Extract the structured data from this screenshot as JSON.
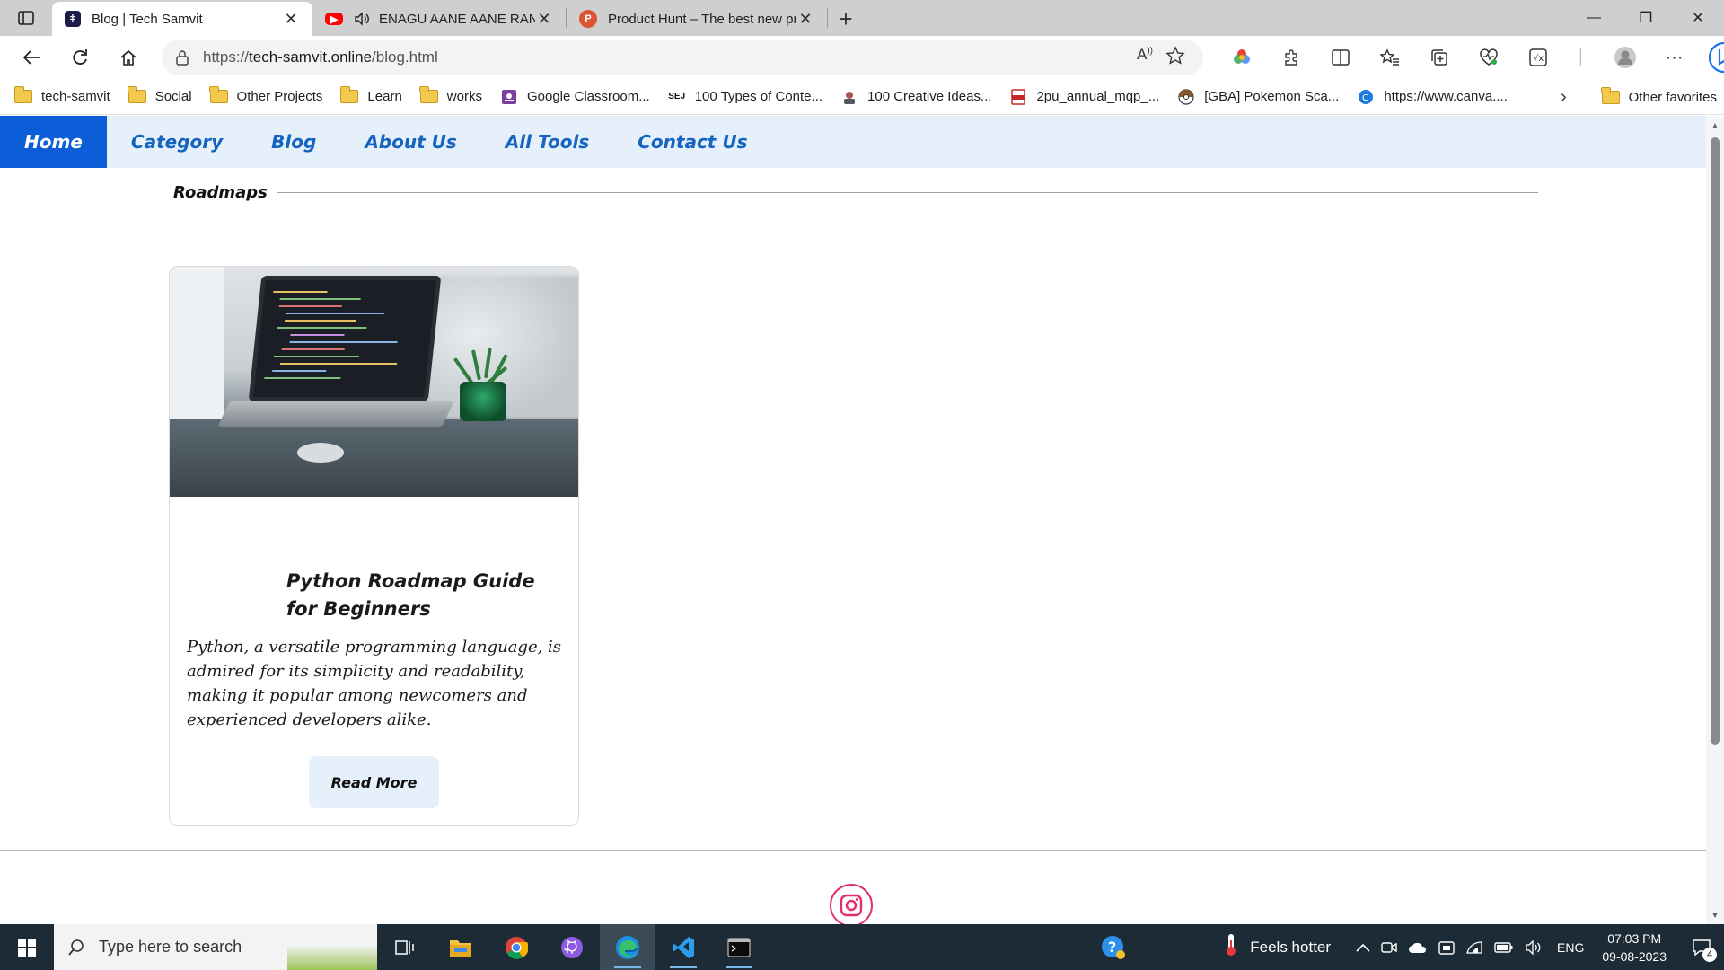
{
  "browser": {
    "tabs": [
      {
        "title": "Blog | Tech Samvit",
        "active": true
      },
      {
        "title": "ENAGU AANE AANE RANGA",
        "active": false
      },
      {
        "title": "Product Hunt – The best new pro",
        "active": false
      }
    ],
    "address": {
      "prefix": "https://",
      "host": "tech-samvit.online",
      "path": "/blog.html"
    },
    "favorites": [
      {
        "label": "tech-samvit",
        "icon": "folder-icon"
      },
      {
        "label": "Social",
        "icon": "folder-icon"
      },
      {
        "label": "Other Projects",
        "icon": "folder-icon"
      },
      {
        "label": "Learn",
        "icon": "folder-icon"
      },
      {
        "label": "works",
        "icon": "folder-icon"
      },
      {
        "label": "Google Classroom...",
        "icon": "classroom-icon"
      },
      {
        "label": "100 Types of Conte...",
        "icon": "sej-icon"
      },
      {
        "label": "100 Creative Ideas...",
        "icon": "person-icon"
      },
      {
        "label": "2pu_annual_mqp_...",
        "icon": "pdf-icon"
      },
      {
        "label": "[GBA] Pokemon Sca...",
        "icon": "pokeball-icon"
      },
      {
        "label": "https://www.canva....",
        "icon": "canva-icon"
      }
    ],
    "other_favorites": "Other favorites"
  },
  "site": {
    "nav": [
      {
        "label": "Home",
        "active": true
      },
      {
        "label": "Category",
        "active": false
      },
      {
        "label": "Blog",
        "active": false
      },
      {
        "label": "About Us",
        "active": false
      },
      {
        "label": "All Tools",
        "active": false
      },
      {
        "label": "Contact Us",
        "active": false
      }
    ],
    "section_title": "Roadmaps",
    "card": {
      "title_line1": "Python Roadmap Guide",
      "title_line2": "for Beginners",
      "text": "Python, a versatile programming language, is admired for its simplicity and readability, making it popular among newcomers and experienced developers alike.",
      "button": "Read More"
    }
  },
  "taskbar": {
    "search_placeholder": "Type here to search",
    "weather": "Feels hotter",
    "language": "ENG",
    "time": "07:03 PM",
    "date": "09-08-2023",
    "notifications": "4"
  },
  "colors": {
    "nav_bg": "#e6f0fb",
    "nav_active": "#0b5ed7",
    "nav_text": "#1565c0",
    "instagram": "#e1306c"
  }
}
